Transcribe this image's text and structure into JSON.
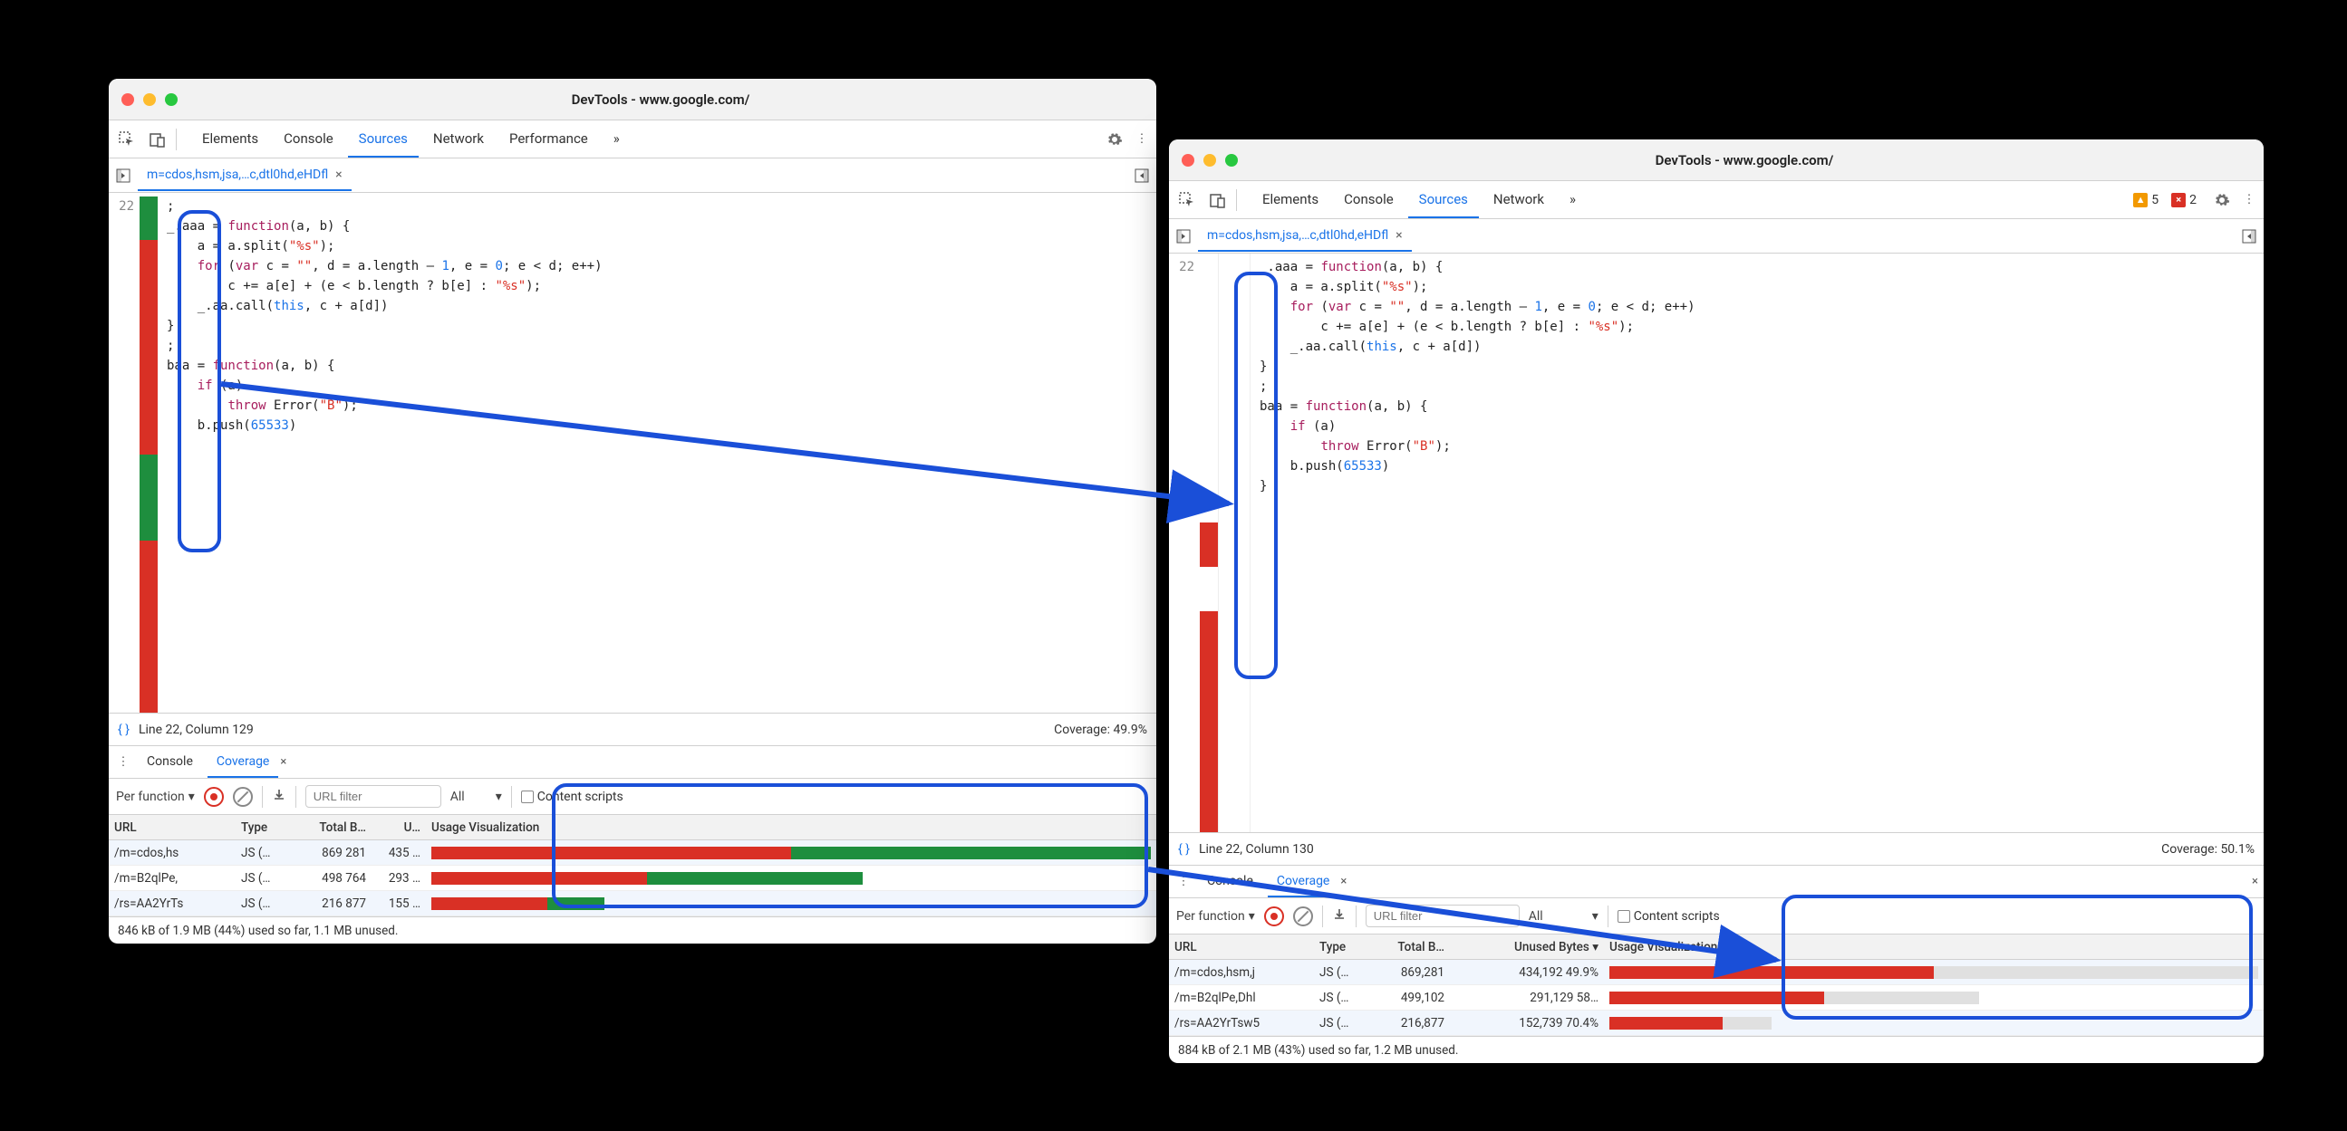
{
  "left": {
    "title": "DevTools - www.google.com/",
    "tabs": [
      "Elements",
      "Console",
      "Sources",
      "Network",
      "Performance"
    ],
    "active_tab": "Sources",
    "more": "»",
    "file_tab": "m=cdos,hsm,jsa,…c,dtl0hd,eHDfl",
    "line_no": "22",
    "status_left": "Line 22, Column 129",
    "status_right": "Coverage: 49.9%",
    "drawer_tabs": [
      "Console",
      "Coverage"
    ],
    "drawer_active": "Coverage",
    "per_fn": "Per function",
    "url_placeholder": "URL filter",
    "type_filter": "All",
    "content_scripts": "Content scripts",
    "headers": {
      "url": "URL",
      "type": "Type",
      "total": "Total B…",
      "unused": "U…",
      "viz": "Usage Visualization"
    },
    "rows": [
      {
        "url": "/m=cdos,hs",
        "type": "JS (…",
        "total": "869 281",
        "unused": "435 …",
        "red": 50,
        "green": 50,
        "width": 100
      },
      {
        "url": "/m=B2qlPe,",
        "type": "JS (…",
        "total": "498 764",
        "unused": "293 …",
        "red": 30,
        "green": 30,
        "width": 60
      },
      {
        "url": "/rs=AA2YrTs",
        "type": "JS (…",
        "total": "216 877",
        "unused": "155 …",
        "red": 16,
        "green": 8,
        "width": 24
      }
    ],
    "footer": "846 kB of 1.9 MB (44%) used so far, 1.1 MB unused."
  },
  "right": {
    "title": "DevTools - www.google.com/",
    "tabs": [
      "Elements",
      "Console",
      "Sources",
      "Network"
    ],
    "active_tab": "Sources",
    "more": "»",
    "warn_count": "5",
    "err_count": "2",
    "file_tab": "m=cdos,hsm,jsa,…c,dtl0hd,eHDfl",
    "line_no": "22",
    "status_left": "Line 22, Column 130",
    "status_right": "Coverage: 50.1%",
    "drawer_tabs": [
      "Console",
      "Coverage"
    ],
    "drawer_active": "Coverage",
    "per_fn": "Per function",
    "url_placeholder": "URL filter",
    "type_filter": "All",
    "content_scripts": "Content scripts",
    "headers": {
      "url": "URL",
      "type": "Type",
      "total": "Total B…",
      "unused": "Unused Bytes",
      "viz": "Usage Visualization"
    },
    "rows": [
      {
        "url": "/m=cdos,hsm,j",
        "type": "JS (…",
        "total": "869,281",
        "unused": "434,192  49.9%",
        "red": 50,
        "width": 100
      },
      {
        "url": "/m=B2qlPe,Dhl",
        "type": "JS (…",
        "total": "499,102",
        "unused": "291,129  58…",
        "red": 33,
        "width": 57
      },
      {
        "url": "/rs=AA2YrTsw5",
        "type": "JS (…",
        "total": "216,877",
        "unused": "152,739  70.4%",
        "red": 17,
        "width": 25
      }
    ],
    "footer": "884 kB of 2.1 MB (43%) used so far, 1.2 MB unused."
  },
  "code": {
    "l1": ";",
    "l2a": "_.aaa = ",
    "l2b": "function",
    "l2c": "(a, b) {",
    "l3a": "    a = a.split(",
    "l3b": "\"%s\"",
    "l3c": ");",
    "l4a": "    ",
    "l4b": "for",
    "l4c": " (",
    "l4d": "var",
    "l4e": " c = ",
    "l4f": "\"\"",
    "l4g": ", d = a.length – ",
    "l4h": "1",
    "l4i": ", e = ",
    "l4j": "0",
    "l4k": "; e < d; e++)",
    "l5a": "        c += a[e] + (e < b.length ? b[e] : ",
    "l5b": "\"%s\"",
    "l5c": ");",
    "l6a": "    _.aa.call(",
    "l6b": "this",
    "l6c": ", c + a[d])",
    "l7": "}",
    "l8": ";",
    "l9a": "baa = ",
    "l9b": "function",
    "l9c": "(a, b) {",
    "l10a": "    ",
    "l10b": "if",
    "l10c": " (a)",
    "l11a": "        ",
    "l11b": "throw",
    "l11c": " Error(",
    "l11d": "\"B\"",
    "l11e": ");",
    "l12a": "    b.push(",
    "l12b": "65533",
    "l12c": ")",
    "l13": "}"
  }
}
